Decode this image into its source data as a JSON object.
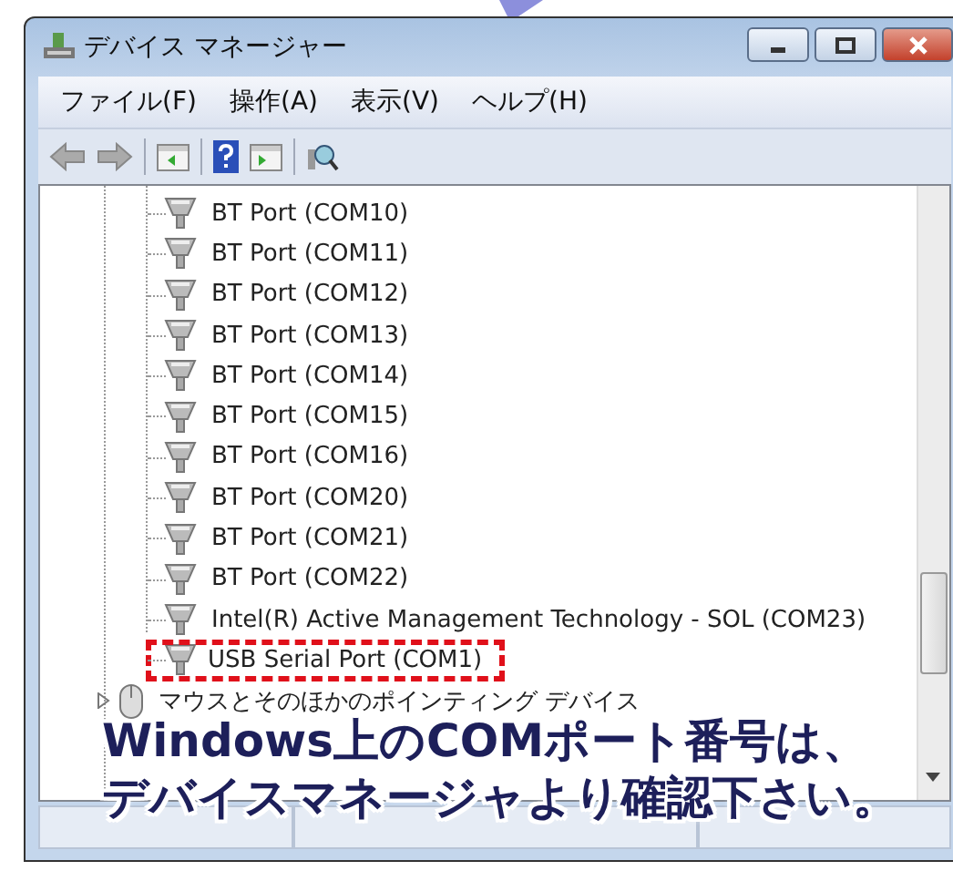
{
  "window": {
    "title": "デバイス マネージャー"
  },
  "menu": [
    "ファイル(F)",
    "操作(A)",
    "表示(V)",
    "ヘルプ(H)"
  ],
  "devices": [
    {
      "label": "BT Port (COM10)",
      "highlighted": false
    },
    {
      "label": "BT Port (COM11)",
      "highlighted": false
    },
    {
      "label": "BT Port (COM12)",
      "highlighted": false
    },
    {
      "label": "BT Port (COM13)",
      "highlighted": false
    },
    {
      "label": "BT Port (COM14)",
      "highlighted": false
    },
    {
      "label": "BT Port (COM15)",
      "highlighted": false
    },
    {
      "label": "BT Port (COM16)",
      "highlighted": false
    },
    {
      "label": "BT Port (COM20)",
      "highlighted": false
    },
    {
      "label": "BT Port (COM21)",
      "highlighted": false
    },
    {
      "label": "BT Port (COM22)",
      "highlighted": false
    },
    {
      "label": "Intel(R) Active Management Technology - SOL (COM23)",
      "highlighted": false
    },
    {
      "label": "USB Serial Port (COM1)",
      "highlighted": true
    }
  ],
  "categories": [
    {
      "label": "マウスとそのほかのポインティング デバイス",
      "expanded": false
    }
  ],
  "callout": {
    "lines": [
      "Windows上のCOMポート番号は、",
      "デバイスマネージャより確認下さい。"
    ]
  }
}
